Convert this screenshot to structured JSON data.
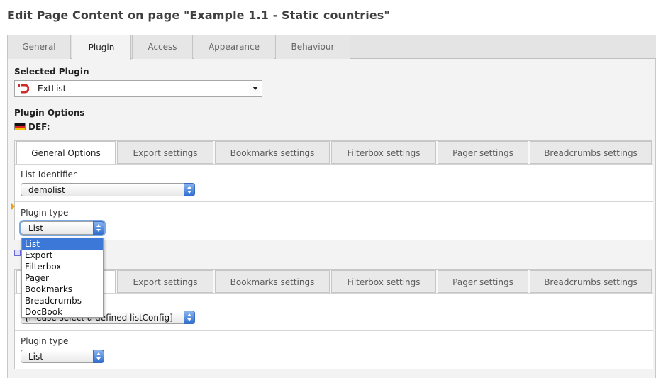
{
  "page": {
    "title": "Edit Page Content on page \"Example 1.1 - Static countries\""
  },
  "top_tabs": [
    {
      "label": "General"
    },
    {
      "label": "Plugin"
    },
    {
      "label": "Access"
    },
    {
      "label": "Appearance"
    },
    {
      "label": "Behaviour"
    }
  ],
  "plugin_section": {
    "heading": "Selected Plugin",
    "selected_value": "ExtList",
    "icon": "extlist-plugin-icon"
  },
  "options_section": {
    "heading": "Plugin Options",
    "language": "DEF:",
    "language_icon": "german-flag-icon"
  },
  "inner_tabs": [
    {
      "label": "General Options"
    },
    {
      "label": "Export settings"
    },
    {
      "label": "Bookmarks settings"
    },
    {
      "label": "Filterbox settings"
    },
    {
      "label": "Pager settings"
    },
    {
      "label": "Breadcrumbs settings"
    }
  ],
  "block1": {
    "list_identifier_label": "List Identifier",
    "list_identifier_value": "demolist",
    "plugin_type_label": "Plugin type",
    "plugin_type_value": "List"
  },
  "dropdown": {
    "options": [
      "List",
      "Export",
      "Filterbox",
      "Pager",
      "Bookmarks",
      "Breadcrumbs",
      "DocBook"
    ],
    "selected": "List"
  },
  "block2": {
    "list_identifier_value": "[Please select a defined listConfig]",
    "plugin_type_label": "Plugin type",
    "plugin_type_value": "List"
  },
  "colors": {
    "accent_blue": "#3b78d8",
    "marker_orange": "#e8a317"
  }
}
